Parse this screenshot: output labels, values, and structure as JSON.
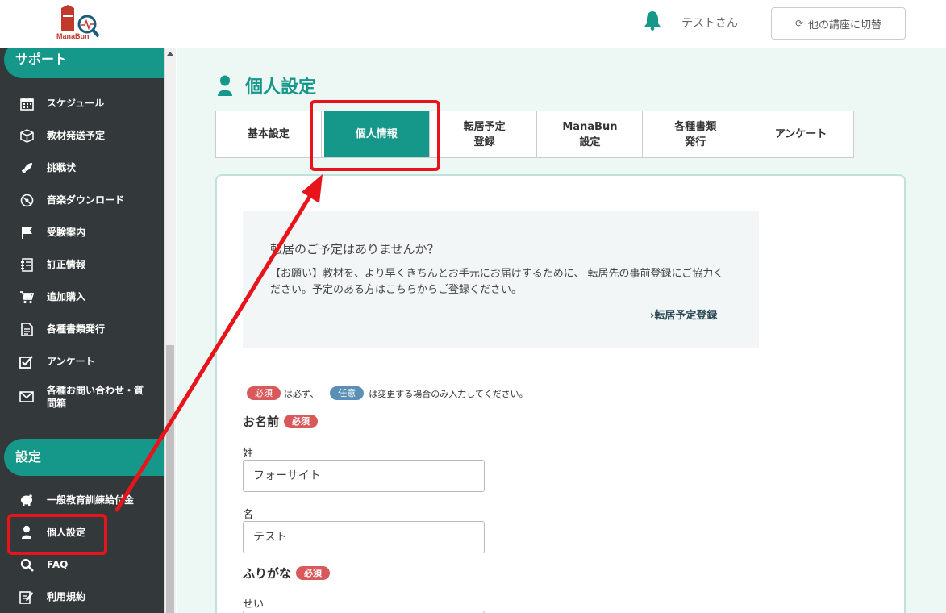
{
  "header": {
    "logo_text": "ManaBun",
    "username": "テストさん",
    "switch_button": "他の講座に切替"
  },
  "sidebar": {
    "support_title": "サポート",
    "support_items": [
      {
        "label": "スケジュール",
        "icon": "calendar-icon"
      },
      {
        "label": "教材発送予定",
        "icon": "box-icon"
      },
      {
        "label": "挑戦状",
        "icon": "rocket-icon"
      },
      {
        "label": "音楽ダウンロード",
        "icon": "music-disc-icon"
      },
      {
        "label": "受験案内",
        "icon": "flag-icon"
      },
      {
        "label": "訂正情報",
        "icon": "correction-icon"
      },
      {
        "label": "追加購入",
        "icon": "cart-icon"
      },
      {
        "label": "各種書類発行",
        "icon": "document-icon"
      },
      {
        "label": "アンケート",
        "icon": "checkbox-icon"
      },
      {
        "label": "各種お問い合わせ・質問箱",
        "icon": "mail-icon"
      }
    ],
    "settings_title": "設定",
    "settings_items": [
      {
        "label": "一般教育訓練給付金",
        "icon": "piggy-bank-icon"
      },
      {
        "label": "個人設定",
        "icon": "user-icon"
      },
      {
        "label": "FAQ",
        "icon": "search-icon"
      },
      {
        "label": "利用規約",
        "icon": "edit-icon"
      }
    ]
  },
  "main": {
    "page_title": "個人設定",
    "tabs": [
      {
        "label": "基本設定",
        "active": false
      },
      {
        "label": "個人情報",
        "active": true
      },
      {
        "label": "転居予定\n登録",
        "active": false
      },
      {
        "label": "ManaBun\n設定",
        "active": false
      },
      {
        "label": "各種書類\n発行",
        "active": false
      },
      {
        "label": "アンケート",
        "active": false
      }
    ],
    "notice": {
      "title": "転居のご予定はありませんか？",
      "body": "【お願い】教材を、より早くきちんとお手元にお届けするために、 転居先の事前登録にご協力ください。予定のある方はこちらからご登録ください。",
      "link": "›転居予定登録"
    },
    "legend": {
      "required_badge": "必須",
      "required_text": "は必ず、",
      "optional_badge": "任意",
      "optional_text": "は変更する場合のみ入力してください。"
    },
    "name_section": {
      "title": "お名前",
      "badge": "必須",
      "last_name_label": "姓",
      "last_name_value": "フォーサイト",
      "first_name_label": "名",
      "first_name_value": "テスト"
    },
    "furigana_section": {
      "title": "ふりがな",
      "badge": "必須",
      "sei_label": "せい"
    }
  },
  "colors": {
    "teal": "#15978a",
    "sidebar_bg": "#33393a",
    "highlight_red": "#e8141c",
    "required_badge": "#d9595b",
    "optional_badge": "#5b8fb5"
  }
}
